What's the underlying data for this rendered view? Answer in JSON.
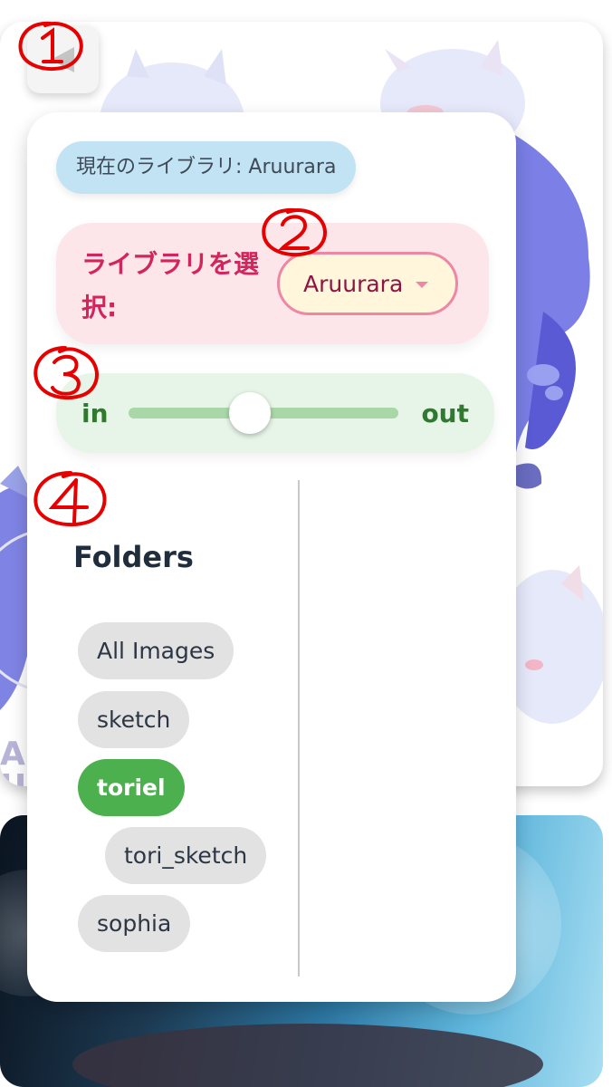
{
  "library": {
    "current_label": "現在のライブラリ: ",
    "current_value": "Aruurara",
    "select_label": "ライブラリを選択:",
    "selected_option": "Aruurara"
  },
  "zoom_slider": {
    "min_label": "in",
    "max_label": "out",
    "value_fraction": 0.45
  },
  "folders": {
    "title": "Folders",
    "items": [
      {
        "label": "All Images",
        "active": false,
        "indent": 0
      },
      {
        "label": "sketch",
        "active": false,
        "indent": 0
      },
      {
        "label": "toriel",
        "active": true,
        "indent": 0
      },
      {
        "label": "tori_sketch",
        "active": false,
        "indent": 1
      },
      {
        "label": "sophia",
        "active": false,
        "indent": 0
      }
    ]
  },
  "markers": [
    "①",
    "②",
    "③",
    "④"
  ],
  "colors": {
    "accent_pink": "#d2255e",
    "accent_green": "#4cb04f",
    "chip_blue": "#c2e3f3",
    "marker_red": "#e60000"
  },
  "icons": {
    "toggle": "triangle-collapse-icon",
    "select_caret": "caret-down-icon"
  }
}
